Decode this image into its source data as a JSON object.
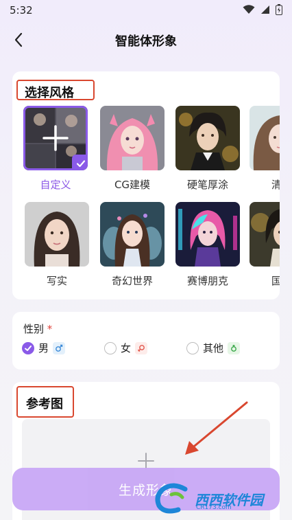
{
  "status_bar": {
    "time": "5:32"
  },
  "header": {
    "title": "智能体形象"
  },
  "style_section": {
    "title": "选择风格",
    "items": [
      {
        "label": "自定义",
        "selected": true,
        "icon": "plus-icon"
      },
      {
        "label": "CG建模",
        "selected": false
      },
      {
        "label": "硬笔厚涂",
        "selected": false
      },
      {
        "label": "清新",
        "selected": false
      },
      {
        "label": "写实",
        "selected": false
      },
      {
        "label": "奇幻世界",
        "selected": false
      },
      {
        "label": "赛博朋克",
        "selected": false
      },
      {
        "label": "国风",
        "selected": false
      }
    ]
  },
  "gender_section": {
    "label": "性别",
    "required_mark": "*",
    "options": [
      {
        "label": "男",
        "selected": true,
        "icon": "male-icon"
      },
      {
        "label": "女",
        "selected": false,
        "icon": "female-icon"
      },
      {
        "label": "其他",
        "selected": false,
        "icon": "other-gender-icon"
      }
    ]
  },
  "reference_section": {
    "title": "参考图"
  },
  "generate_button": {
    "label": "生成形象"
  },
  "watermark": {
    "text": "西西软件园",
    "sub": "CR173.com"
  },
  "colors": {
    "accent": "#8a5ae8",
    "highlight": "#d9472f",
    "button": "#c8a8f6"
  }
}
